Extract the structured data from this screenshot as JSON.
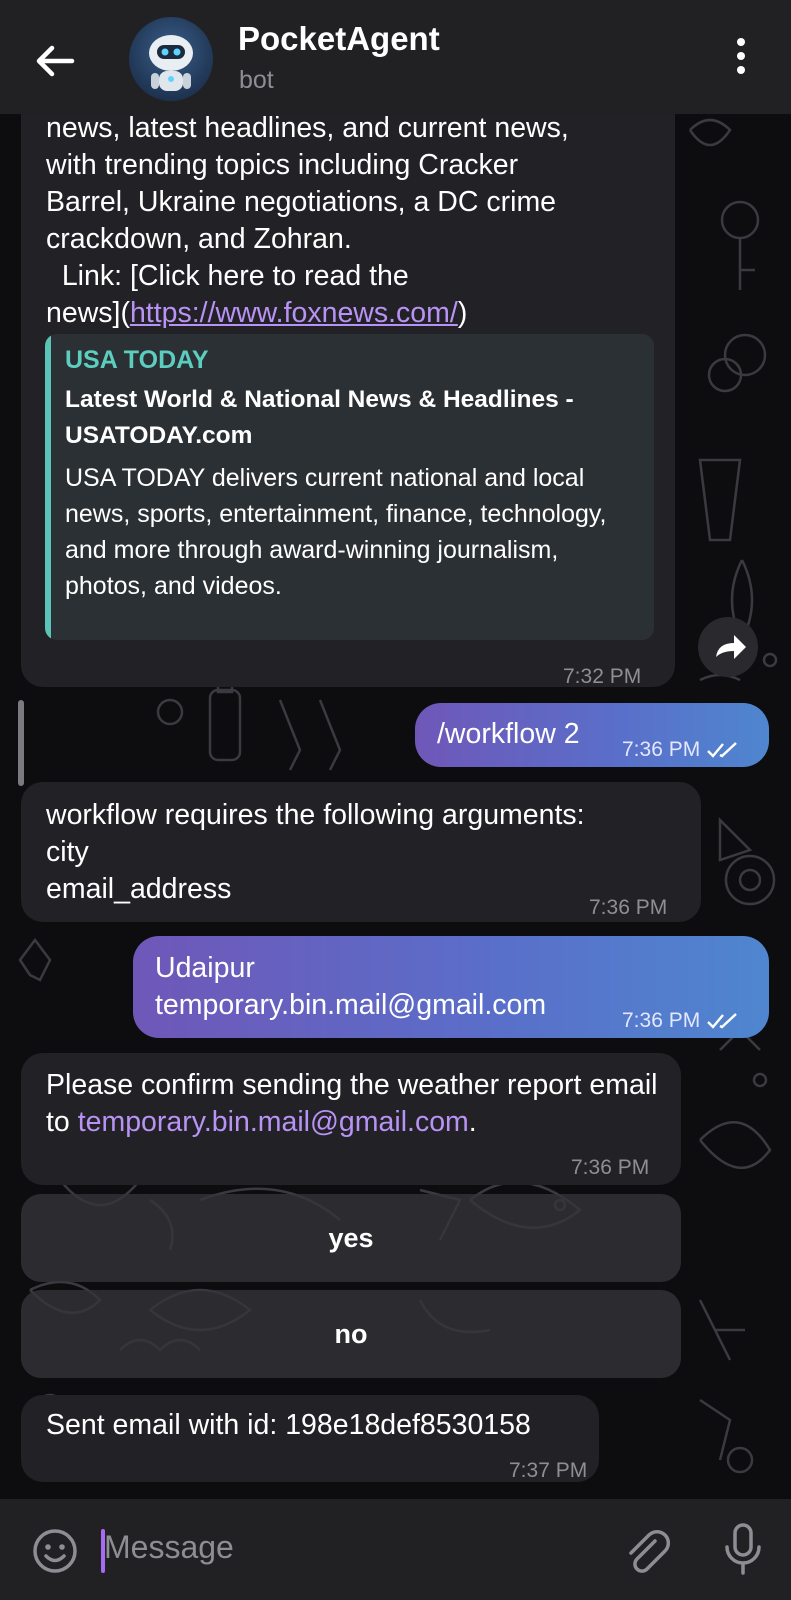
{
  "header": {
    "title": "PocketAgent",
    "subtitle": "bot"
  },
  "messages": {
    "news": {
      "lines": [
        "news, latest headlines, and current news,",
        "with trending topics including Cracker",
        "Barrel, Ukraine negotiations, a DC crime",
        "crackdown, and Zohran.",
        "  Link: [Click here to read the"
      ],
      "link_prefix": "news](",
      "link_text": "https://www.foxnews.com/",
      "link_suffix": ")",
      "preview": {
        "site": "USA TODAY",
        "title": "Latest World & National News & Headlines - USATODAY.com",
        "description": "USA TODAY delivers current national and local news, sports, entertainment, finance, technology, and more through award-winning journalism, photos, and videos."
      },
      "time": "7:32 PM"
    },
    "workflow_cmd": {
      "text": "/workflow 2",
      "time": "7:36 PM"
    },
    "args_request": {
      "lines": [
        "workflow requires the following arguments:",
        "city",
        "email_address"
      ],
      "time": "7:36 PM"
    },
    "args_reply": {
      "lines": [
        "Udaipur",
        "temporary.bin.mail@gmail.com"
      ],
      "time": "7:36 PM"
    },
    "confirm": {
      "text": "Please confirm sending the weather report email to ",
      "email": "temporary.bin.mail@gmail.com",
      "suffix": ".",
      "time": "7:36 PM"
    },
    "buttons": {
      "yes": "yes",
      "no": "no"
    },
    "sent": {
      "text": "Sent email with id: 198e18def8530158",
      "time": "7:37 PM"
    }
  },
  "input": {
    "placeholder": "Message"
  },
  "icons": {
    "back": "arrow-left-icon",
    "menu": "more-vertical-icon",
    "forward": "share-icon",
    "emoji": "smile-icon",
    "attach": "paperclip-icon",
    "mic": "microphone-icon",
    "ticks": "double-check-icon"
  },
  "colors": {
    "header_bg": "#212124",
    "incoming_bubble": "#222226",
    "outgoing_gradient_start": "#6f57b8",
    "outgoing_gradient_end": "#4f86cf",
    "link": "#b892f5",
    "preview_site": "#5ccdbf"
  }
}
